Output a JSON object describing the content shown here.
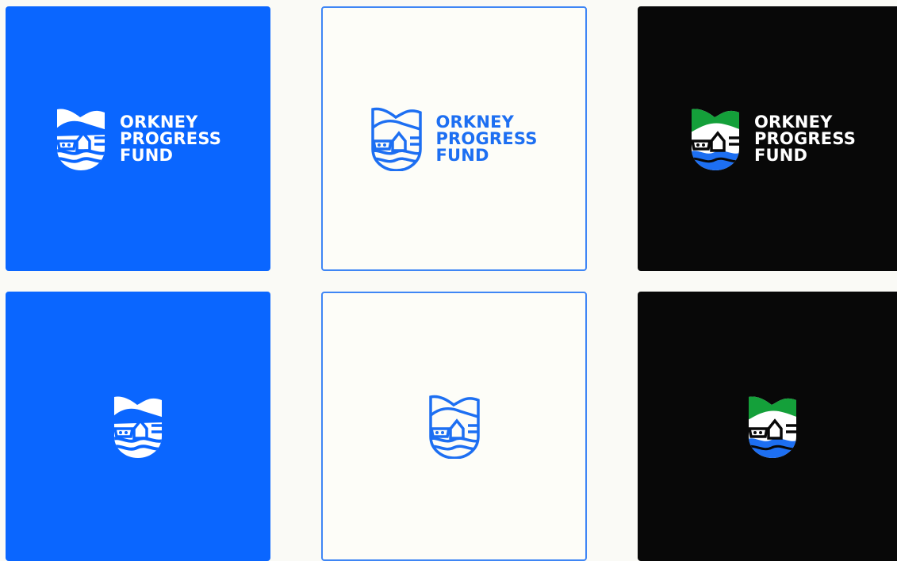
{
  "logo": {
    "line1": "ORKNEY",
    "line2": "PROGRESS",
    "line3": "FUND",
    "icon": "shield-crest-icon"
  },
  "variants": [
    {
      "name": "primary-blue",
      "background": "#0a66ff",
      "mark_color": "#ffffff"
    },
    {
      "name": "outline-light",
      "background": "#fdfdf8",
      "border": "#3f86f5",
      "mark_color": "#1d6ff2"
    },
    {
      "name": "full-colour-dark",
      "background": "#080808",
      "mark_color": "#ffffff",
      "accent_green": "#14a03a",
      "accent_blue": "#1d6ff2"
    }
  ]
}
